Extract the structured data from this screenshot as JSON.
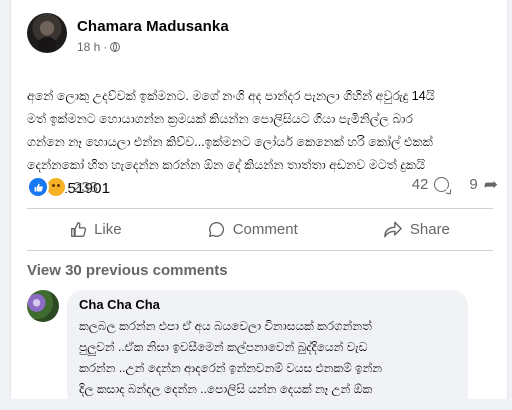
{
  "post": {
    "author": "Chamara Madusanka",
    "time": "18 h",
    "separator": "·",
    "text": "අනේ ලොකු උදව්වක් ඉක්මනට. මගේ නංගි අද පාන්දර පැනලා ගිහින් අවුරුදු 14යි\nමත් ඉක්මනට හොයාගන්න ක්‍රමයක් කියන්න පොලිසියට ගියා පැමිනිල්ල බාර\nගන්නෙ නෑ හොයලා එන්න කිව්ව...ඉක්මනට ලෝයර් කෙනෙක් හරි කෝල් එකක්\nදෙන්නකෝ හිත හැදෙන්න කරන්න ඕන දේ කියන්න තාත්තා අඩනව මටත් දුකයි",
    "phone": "0711151901",
    "reactions_count": "233",
    "comments_count": "42",
    "shares_count": "9"
  },
  "actions": {
    "like": "Like",
    "comment": "Comment",
    "share": "Share"
  },
  "comments": {
    "view_previous": "View 30 previous comments",
    "items": [
      {
        "author": "Cha Cha Cha",
        "text": "කලබල කරන්න එපා ඒ අය බයවෙලා විනාසයක් කරගන්නත්\nපුලුවන් ..ඒක නිසා ඉවසීමෙන් කල්පනාවෙන් බුද්දියෙන් වැඩ\nකරන්න ..උන් දෙන්න ආදරෙන් ඉන්නවනම් වයස එනකම් ඉන්න\nදිල කසාද බන්දල දෙන්න ..පොලිසි යන්න දෙයක් නෑ උන් ඕක"
      }
    ]
  },
  "colors": {
    "accent": "#1877f2",
    "muted": "#65676b",
    "background": "#f0f2f5"
  },
  "icons": [
    "globe-icon",
    "like-reaction-icon",
    "sad-reaction-icon",
    "comment-icon",
    "share-icon",
    "like-icon"
  ]
}
